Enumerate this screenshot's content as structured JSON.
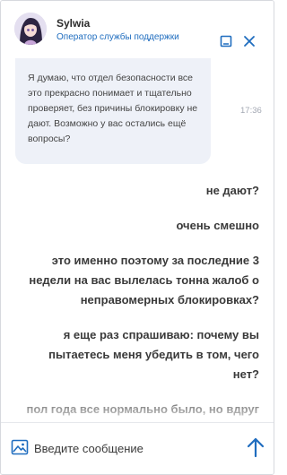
{
  "header": {
    "agent_name": "Sylwia",
    "agent_role": "Оператор службы поддержки",
    "minimize_icon": "minimize-icon",
    "close_icon": "close-icon"
  },
  "messages": {
    "agent": {
      "text": "Я думаю, что отдел безопасности все это прекрасно понимает и тщательно проверяет, без причины блокировку не дают.  Возможно у вас остались ещё вопросы?",
      "time": "17:36"
    },
    "user": [
      {
        "lines": [
          "не дают?"
        ]
      },
      {
        "lines": [
          "очень смешно"
        ]
      },
      {
        "lines": [
          "это именно поэтому за последние 3",
          "недели на вас вылелась тонна жалоб о",
          "неправомерных блокировках?"
        ]
      },
      {
        "lines": [
          "я еще раз спрашиваю: почему вы",
          "пытаетесь меня убедить в том, чего",
          "нет?"
        ]
      },
      {
        "lines": [
          "пол года все нормально было, но вдруг"
        ]
      }
    ]
  },
  "composer": {
    "placeholder": "Введите сообщение",
    "attach_icon": "image-icon",
    "send_icon": "arrow-up-icon"
  },
  "colors": {
    "accent": "#1f6dbf",
    "agent_bubble": "#eef1f8",
    "text": "#3a3a3a"
  }
}
